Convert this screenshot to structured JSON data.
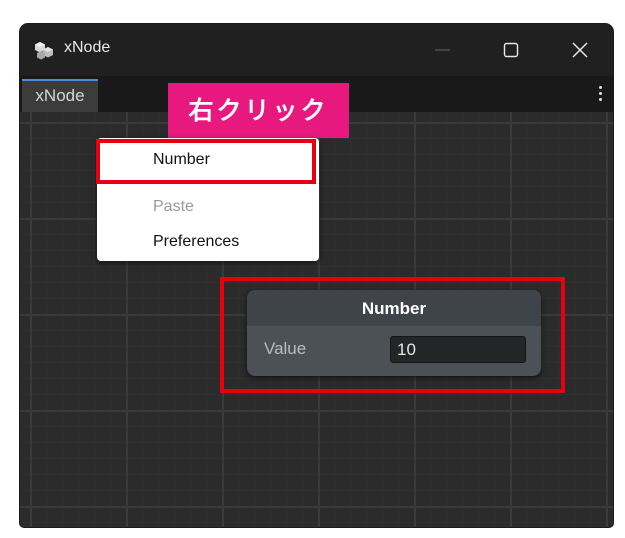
{
  "window": {
    "title": "xNode",
    "icon": "xnode-app-icon"
  },
  "tabs": [
    {
      "label": "xNode"
    }
  ],
  "callout": {
    "text": "右クリック",
    "color": "#e8197e"
  },
  "context_menu": {
    "items": [
      {
        "label": "Number",
        "enabled": true,
        "highlighted": true
      },
      {
        "label": "Paste",
        "enabled": false
      },
      {
        "label": "Preferences",
        "enabled": true
      }
    ]
  },
  "node": {
    "title": "Number",
    "field_label": "Value",
    "field_value": "10"
  },
  "colors": {
    "highlight": "#e60012",
    "accent": "#4a90d9"
  }
}
